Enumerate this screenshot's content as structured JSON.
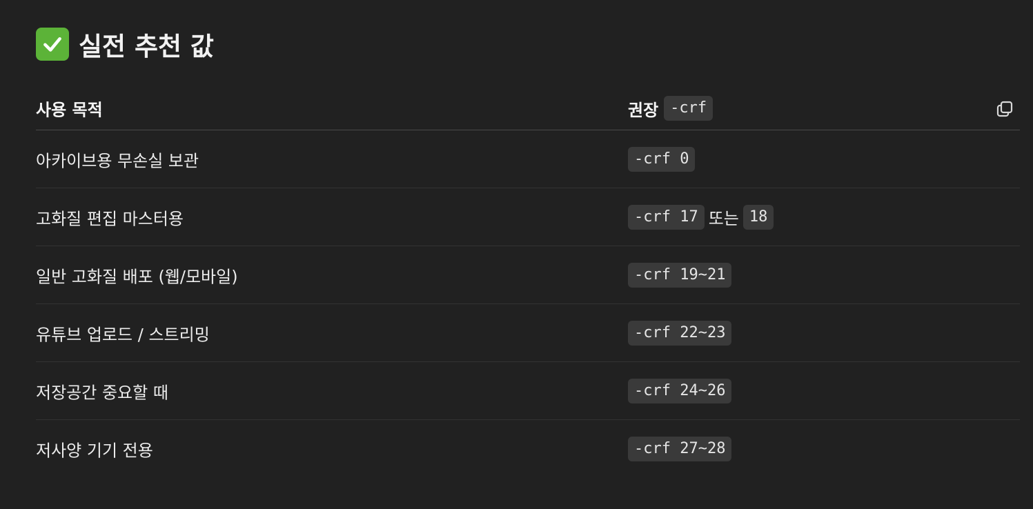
{
  "heading": {
    "icon": "check-mark-button-icon",
    "text": "실전 추천 값"
  },
  "table": {
    "headers": {
      "purpose": "사용 목적",
      "recommended_label": "권장",
      "recommended_code": "-crf"
    },
    "copy_icon": "copy-icon",
    "rows": [
      {
        "purpose": "아카이브용 무손실 보관",
        "code": "-crf 0"
      },
      {
        "purpose": "고화질 편집 마스터용",
        "code": "-crf 17",
        "connector": "또는",
        "code2": "18"
      },
      {
        "purpose": "일반 고화질 배포 (웹/모바일)",
        "code": "-crf 19~21"
      },
      {
        "purpose": "유튜브 업로드 / 스트리밍",
        "code": "-crf 22~23"
      },
      {
        "purpose": "저장공간 중요할 때",
        "code": "-crf 24~26"
      },
      {
        "purpose": "저사양 기기 전용",
        "code": "-crf 27~28"
      }
    ]
  },
  "colors": {
    "background": "#212121",
    "code_background": "#3a3a3a",
    "check_green": "#5cb338"
  }
}
